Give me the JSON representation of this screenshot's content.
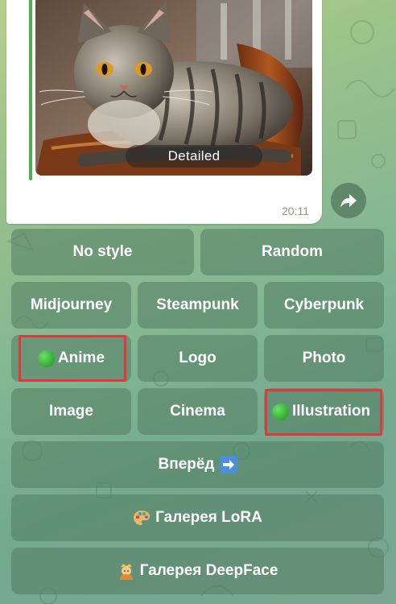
{
  "message": {
    "image_caption": "Detailed",
    "time": "20:11",
    "image_subject": "tabby cat lying on an ornate wooden chair"
  },
  "icons": {
    "forward": "forward-arrow-icon",
    "dot": "green-circle-icon",
    "palette": "artist-palette-icon",
    "person": "person-emoji-icon",
    "next_arrow": "right-arrow-icon"
  },
  "keyboard": {
    "rows": [
      [
        "No style",
        "Random"
      ],
      [
        "Midjourney",
        "Steampunk",
        "Cyberpunk"
      ],
      [
        "Anime",
        "Logo",
        "Photo"
      ],
      [
        "Image",
        "Cinema",
        "Illustration"
      ],
      [
        "Вперёд"
      ],
      [
        "Галерея LoRA"
      ],
      [
        "Галерея DeepFace"
      ]
    ],
    "selected": [
      "Anime",
      "Illustration"
    ]
  },
  "colors": {
    "highlight": "#e0383c",
    "accent_bar": "#4fae4e",
    "selected_dot": "#3cb43a"
  }
}
